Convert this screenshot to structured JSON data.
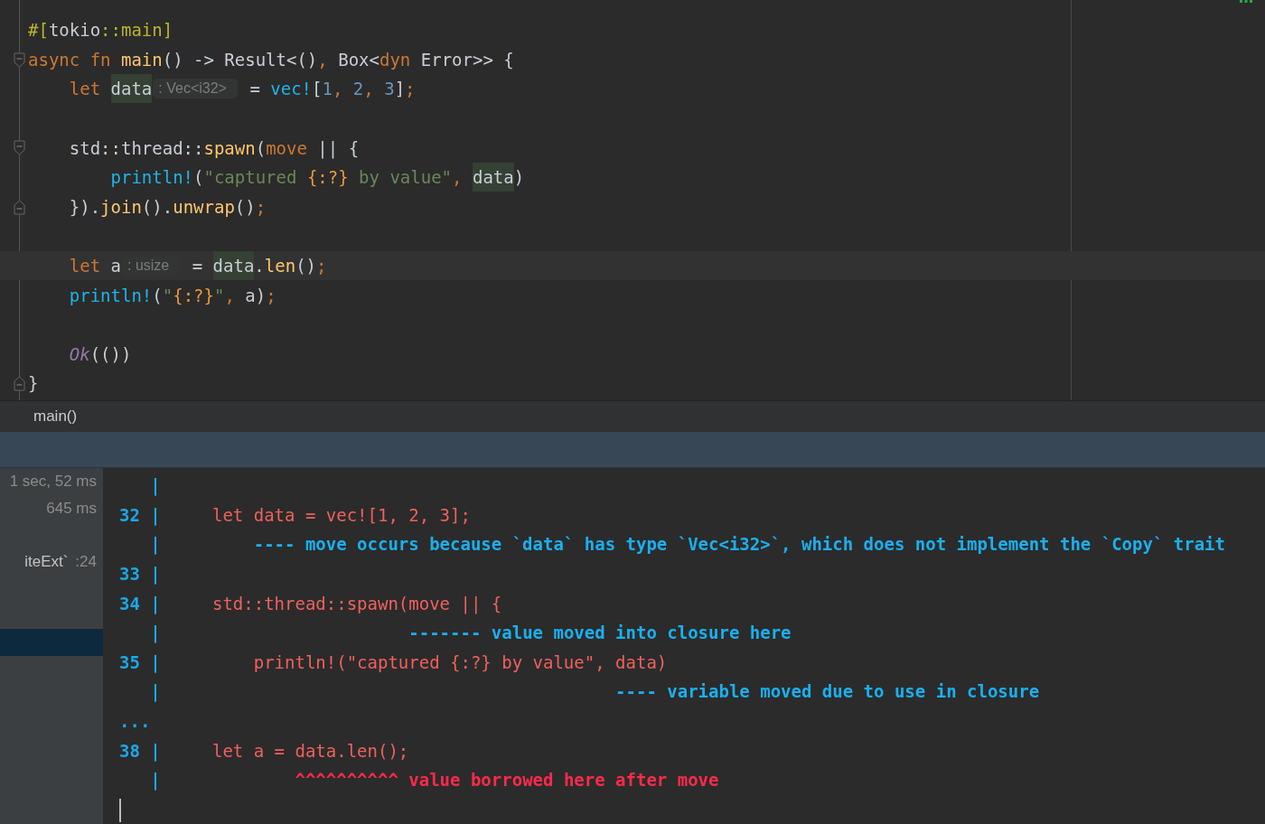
{
  "editor": {
    "lines": [
      {
        "fold_start": false,
        "fold_end": false,
        "current": false,
        "tokens": [
          {
            "text": "#[",
            "kind": "attr"
          },
          {
            "text": "tokio",
            "kind": "plain"
          },
          {
            "text": "::main]",
            "kind": "attr"
          }
        ]
      },
      {
        "fold_start": true,
        "fold_end": false,
        "current": false,
        "tokens": [
          {
            "text": "async fn ",
            "kind": "keyword"
          },
          {
            "text": "main",
            "kind": "function"
          },
          {
            "text": "() -> Result<()",
            "kind": "plain"
          },
          {
            "text": ",",
            "kind": "keyword"
          },
          {
            "text": " Box<",
            "kind": "plain"
          },
          {
            "text": "dyn",
            "kind": "keyword"
          },
          {
            "text": " Error>> {",
            "kind": "plain"
          }
        ]
      },
      {
        "fold_start": false,
        "fold_end": false,
        "current": false,
        "tokens": [
          {
            "text": "    let ",
            "kind": "keyword"
          },
          {
            "text": "data",
            "kind": "ref"
          },
          {
            "text": ": Vec<i32>",
            "kind": "hint"
          },
          {
            "text": " = ",
            "kind": "plain"
          },
          {
            "text": "vec!",
            "kind": "macro"
          },
          {
            "text": "[",
            "kind": "plain"
          },
          {
            "text": "1",
            "kind": "number"
          },
          {
            "text": ",",
            "kind": "keyword"
          },
          {
            "text": " 2",
            "kind": "number"
          },
          {
            "text": ",",
            "kind": "keyword"
          },
          {
            "text": " 3",
            "kind": "number"
          },
          {
            "text": "]",
            "kind": "plain"
          },
          {
            "text": ";",
            "kind": "keyword"
          }
        ]
      },
      {
        "fold_start": false,
        "fold_end": false,
        "current": false
      },
      {
        "fold_start": true,
        "fold_end": false,
        "current": false,
        "tokens": [
          {
            "text": "    std::thread::",
            "kind": "plain"
          },
          {
            "text": "spawn",
            "kind": "function"
          },
          {
            "text": "(",
            "kind": "plain"
          },
          {
            "text": "move",
            "kind": "keyword"
          },
          {
            "text": " || {",
            "kind": "plain"
          }
        ]
      },
      {
        "fold_start": false,
        "fold_end": false,
        "current": false,
        "tokens": [
          {
            "text": "        println!",
            "kind": "macro"
          },
          {
            "text": "(",
            "kind": "plain"
          },
          {
            "text": "\"captured ",
            "kind": "string"
          },
          {
            "text": "{:?}",
            "kind": "format"
          },
          {
            "text": " by value\"",
            "kind": "string"
          },
          {
            "text": ", ",
            "kind": "keyword"
          },
          {
            "text": "data",
            "kind": "ref"
          },
          {
            "text": ")",
            "kind": "plain"
          }
        ]
      },
      {
        "fold_start": false,
        "fold_end": true,
        "current": false,
        "tokens": [
          {
            "text": "    }).",
            "kind": "plain"
          },
          {
            "text": "join",
            "kind": "function"
          },
          {
            "text": "().",
            "kind": "plain"
          },
          {
            "text": "unwrap",
            "kind": "function"
          },
          {
            "text": "()",
            "kind": "plain"
          },
          {
            "text": ";",
            "kind": "keyword"
          }
        ]
      },
      {
        "fold_start": false,
        "fold_end": false,
        "current": false
      },
      {
        "fold_start": false,
        "fold_end": false,
        "current": true,
        "tokens": [
          {
            "text": "    let ",
            "kind": "keyword"
          },
          {
            "text": "a",
            "kind": "plain"
          },
          {
            "text": ": usize",
            "kind": "hint"
          },
          {
            "text": " = ",
            "kind": "plain"
          },
          {
            "text": "data",
            "kind": "ref"
          },
          {
            "text": ".",
            "kind": "plain"
          },
          {
            "text": "len",
            "kind": "function"
          },
          {
            "text": "()",
            "kind": "plain"
          },
          {
            "text": ";",
            "kind": "keyword"
          }
        ]
      },
      {
        "fold_start": false,
        "fold_end": false,
        "current": false,
        "tokens": [
          {
            "text": "    println!",
            "kind": "macro"
          },
          {
            "text": "(",
            "kind": "plain"
          },
          {
            "text": "\"",
            "kind": "string"
          },
          {
            "text": "{:?}",
            "kind": "format"
          },
          {
            "text": "\"",
            "kind": "string"
          },
          {
            "text": ",",
            "kind": "keyword"
          },
          {
            "text": " a)",
            "kind": "plain"
          },
          {
            "text": ";",
            "kind": "keyword"
          }
        ]
      },
      {
        "fold_start": false,
        "fold_end": false,
        "current": false
      },
      {
        "fold_start": false,
        "fold_end": false,
        "current": false,
        "tokens": [
          {
            "text": "    Ok",
            "kind": "ok"
          },
          {
            "text": "(())",
            "kind": "plain"
          }
        ]
      },
      {
        "fold_start": false,
        "fold_end": true,
        "current": false,
        "tokens": [
          {
            "text": "}",
            "kind": "plain"
          }
        ]
      }
    ]
  },
  "breadcrumb": "main()",
  "side_panel": {
    "rows": [
      {
        "selected": false,
        "text": "1 sec, 52 ms"
      },
      {
        "selected": false,
        "text": "645 ms"
      },
      {
        "selected": false
      },
      {
        "selected": false,
        "text": "iteExt`",
        "suffix": ":24"
      },
      {
        "selected": false
      },
      {
        "selected": false
      },
      {
        "selected": true
      }
    ]
  },
  "console": {
    "rows": [
      {
        "pipe": "|"
      },
      {
        "gutter": "32",
        "pipe": "|",
        "segments": [
          {
            "text": "     let data = vec![1, 2, 3];",
            "kind": "code"
          }
        ]
      },
      {
        "pipe": "|",
        "segments": [
          {
            "text": "         ---- move occurs because `data` has type `Vec<i32>`, which does not implement the `Copy` trait",
            "kind": "note"
          }
        ]
      },
      {
        "gutter": "33",
        "pipe": "|"
      },
      {
        "gutter": "34",
        "pipe": "|",
        "segments": [
          {
            "text": "     std::thread::spawn(move || {",
            "kind": "code"
          }
        ]
      },
      {
        "pipe": "|",
        "segments": [
          {
            "text": "                        ------- value moved into closure here",
            "kind": "note"
          }
        ]
      },
      {
        "gutter": "35",
        "pipe": "|",
        "segments": [
          {
            "text": "         println!(\"captured {:?} by value\", data)",
            "kind": "code"
          }
        ]
      },
      {
        "pipe": "|",
        "segments": [
          {
            "text": "                                            ---- variable moved due to use in closure",
            "kind": "note"
          }
        ]
      },
      {
        "gutter": "..."
      },
      {
        "gutter": "38",
        "pipe": "|",
        "segments": [
          {
            "text": "     let a = data.len();",
            "kind": "code"
          }
        ]
      },
      {
        "pipe": "|",
        "segments": [
          {
            "text": "             ^^^^^^^^^^ value borrowed here after move",
            "kind": "error"
          }
        ]
      }
    ]
  }
}
